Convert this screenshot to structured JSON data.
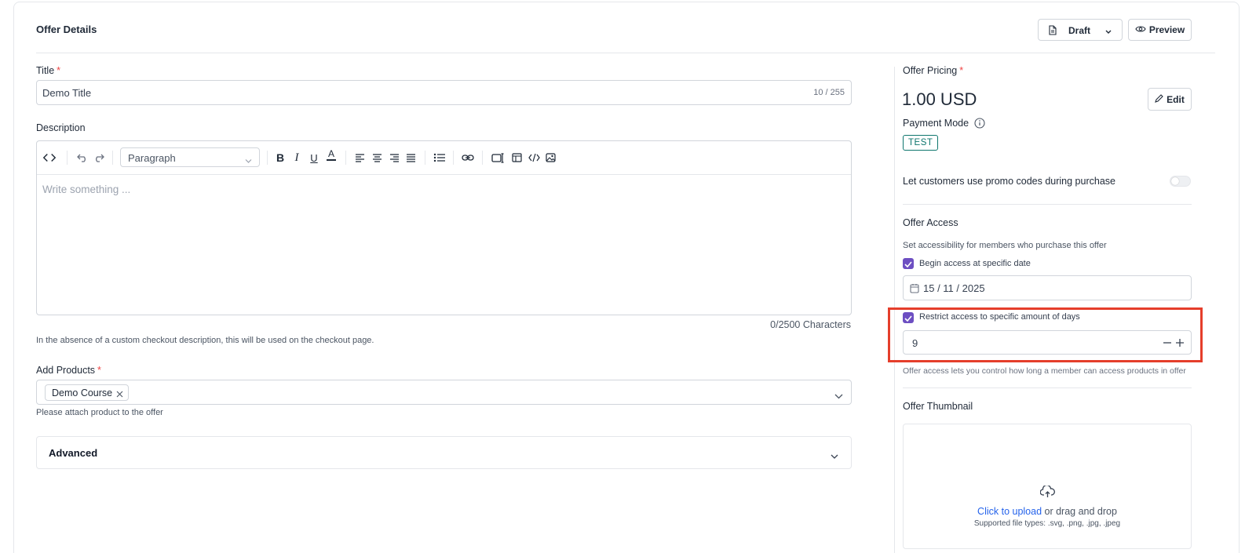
{
  "header": {
    "title": "Offer Details",
    "status_label": "Draft",
    "preview_label": "Preview"
  },
  "title_field": {
    "label": "Title",
    "required_mark": "*",
    "value": "Demo Title",
    "counter": "10 / 255"
  },
  "description": {
    "label": "Description",
    "block_type": "Paragraph",
    "placeholder": "Write something ...",
    "char_count": "0/2500 Characters",
    "help_text": "In the absence of a custom checkout description, this will be used on the checkout page."
  },
  "products": {
    "label": "Add Products",
    "required_mark": "*",
    "chip": "Demo Course",
    "help_text": "Please attach product to the offer"
  },
  "advanced": {
    "label": "Advanced"
  },
  "pricing": {
    "label": "Offer Pricing",
    "required_mark": "*",
    "amount": "1.00 USD",
    "edit_label": "Edit",
    "payment_mode_label": "Payment Mode",
    "payment_mode_badge": "TEST"
  },
  "promo": {
    "label": "Let customers use promo codes during purchase",
    "enabled": false
  },
  "access": {
    "title": "Offer Access",
    "subtitle": "Set accessibility for members who purchase this offer",
    "begin_label": "Begin access at specific date",
    "begin_checked": true,
    "date_value": "15 / 11 / 2025",
    "restrict_label": "Restrict access to specific amount of days",
    "restrict_checked": true,
    "days_value": "9",
    "help_text": "Offer access lets you control how long a member can access products in offer"
  },
  "thumbnail": {
    "title": "Offer Thumbnail",
    "upload_link": "Click to upload",
    "upload_rest": " or drag and drop",
    "supported": "Supported file types: .svg, .png, .jpg, .jpeg"
  },
  "colors": {
    "accent": "#6d4fc2",
    "link": "#2563eb",
    "highlight": "#e53e2b",
    "badge": "#0f766e",
    "required": "#ef4444"
  }
}
